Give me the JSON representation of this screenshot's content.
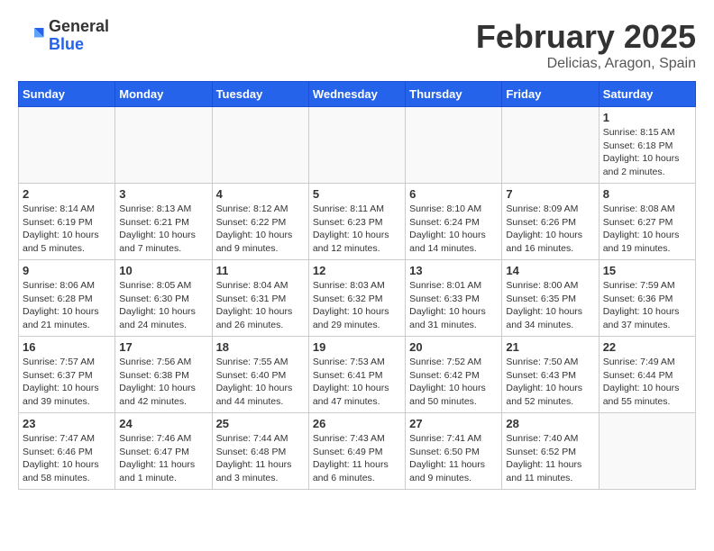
{
  "header": {
    "logo_general": "General",
    "logo_blue": "Blue",
    "title": "February 2025",
    "subtitle": "Delicias, Aragon, Spain"
  },
  "weekdays": [
    "Sunday",
    "Monday",
    "Tuesday",
    "Wednesday",
    "Thursday",
    "Friday",
    "Saturday"
  ],
  "weeks": [
    [
      {
        "day": "",
        "info": ""
      },
      {
        "day": "",
        "info": ""
      },
      {
        "day": "",
        "info": ""
      },
      {
        "day": "",
        "info": ""
      },
      {
        "day": "",
        "info": ""
      },
      {
        "day": "",
        "info": ""
      },
      {
        "day": "1",
        "info": "Sunrise: 8:15 AM\nSunset: 6:18 PM\nDaylight: 10 hours\nand 2 minutes."
      }
    ],
    [
      {
        "day": "2",
        "info": "Sunrise: 8:14 AM\nSunset: 6:19 PM\nDaylight: 10 hours\nand 5 minutes."
      },
      {
        "day": "3",
        "info": "Sunrise: 8:13 AM\nSunset: 6:21 PM\nDaylight: 10 hours\nand 7 minutes."
      },
      {
        "day": "4",
        "info": "Sunrise: 8:12 AM\nSunset: 6:22 PM\nDaylight: 10 hours\nand 9 minutes."
      },
      {
        "day": "5",
        "info": "Sunrise: 8:11 AM\nSunset: 6:23 PM\nDaylight: 10 hours\nand 12 minutes."
      },
      {
        "day": "6",
        "info": "Sunrise: 8:10 AM\nSunset: 6:24 PM\nDaylight: 10 hours\nand 14 minutes."
      },
      {
        "day": "7",
        "info": "Sunrise: 8:09 AM\nSunset: 6:26 PM\nDaylight: 10 hours\nand 16 minutes."
      },
      {
        "day": "8",
        "info": "Sunrise: 8:08 AM\nSunset: 6:27 PM\nDaylight: 10 hours\nand 19 minutes."
      }
    ],
    [
      {
        "day": "9",
        "info": "Sunrise: 8:06 AM\nSunset: 6:28 PM\nDaylight: 10 hours\nand 21 minutes."
      },
      {
        "day": "10",
        "info": "Sunrise: 8:05 AM\nSunset: 6:30 PM\nDaylight: 10 hours\nand 24 minutes."
      },
      {
        "day": "11",
        "info": "Sunrise: 8:04 AM\nSunset: 6:31 PM\nDaylight: 10 hours\nand 26 minutes."
      },
      {
        "day": "12",
        "info": "Sunrise: 8:03 AM\nSunset: 6:32 PM\nDaylight: 10 hours\nand 29 minutes."
      },
      {
        "day": "13",
        "info": "Sunrise: 8:01 AM\nSunset: 6:33 PM\nDaylight: 10 hours\nand 31 minutes."
      },
      {
        "day": "14",
        "info": "Sunrise: 8:00 AM\nSunset: 6:35 PM\nDaylight: 10 hours\nand 34 minutes."
      },
      {
        "day": "15",
        "info": "Sunrise: 7:59 AM\nSunset: 6:36 PM\nDaylight: 10 hours\nand 37 minutes."
      }
    ],
    [
      {
        "day": "16",
        "info": "Sunrise: 7:57 AM\nSunset: 6:37 PM\nDaylight: 10 hours\nand 39 minutes."
      },
      {
        "day": "17",
        "info": "Sunrise: 7:56 AM\nSunset: 6:38 PM\nDaylight: 10 hours\nand 42 minutes."
      },
      {
        "day": "18",
        "info": "Sunrise: 7:55 AM\nSunset: 6:40 PM\nDaylight: 10 hours\nand 44 minutes."
      },
      {
        "day": "19",
        "info": "Sunrise: 7:53 AM\nSunset: 6:41 PM\nDaylight: 10 hours\nand 47 minutes."
      },
      {
        "day": "20",
        "info": "Sunrise: 7:52 AM\nSunset: 6:42 PM\nDaylight: 10 hours\nand 50 minutes."
      },
      {
        "day": "21",
        "info": "Sunrise: 7:50 AM\nSunset: 6:43 PM\nDaylight: 10 hours\nand 52 minutes."
      },
      {
        "day": "22",
        "info": "Sunrise: 7:49 AM\nSunset: 6:44 PM\nDaylight: 10 hours\nand 55 minutes."
      }
    ],
    [
      {
        "day": "23",
        "info": "Sunrise: 7:47 AM\nSunset: 6:46 PM\nDaylight: 10 hours\nand 58 minutes."
      },
      {
        "day": "24",
        "info": "Sunrise: 7:46 AM\nSunset: 6:47 PM\nDaylight: 11 hours\nand 1 minute."
      },
      {
        "day": "25",
        "info": "Sunrise: 7:44 AM\nSunset: 6:48 PM\nDaylight: 11 hours\nand 3 minutes."
      },
      {
        "day": "26",
        "info": "Sunrise: 7:43 AM\nSunset: 6:49 PM\nDaylight: 11 hours\nand 6 minutes."
      },
      {
        "day": "27",
        "info": "Sunrise: 7:41 AM\nSunset: 6:50 PM\nDaylight: 11 hours\nand 9 minutes."
      },
      {
        "day": "28",
        "info": "Sunrise: 7:40 AM\nSunset: 6:52 PM\nDaylight: 11 hours\nand 11 minutes."
      },
      {
        "day": "",
        "info": ""
      }
    ]
  ]
}
